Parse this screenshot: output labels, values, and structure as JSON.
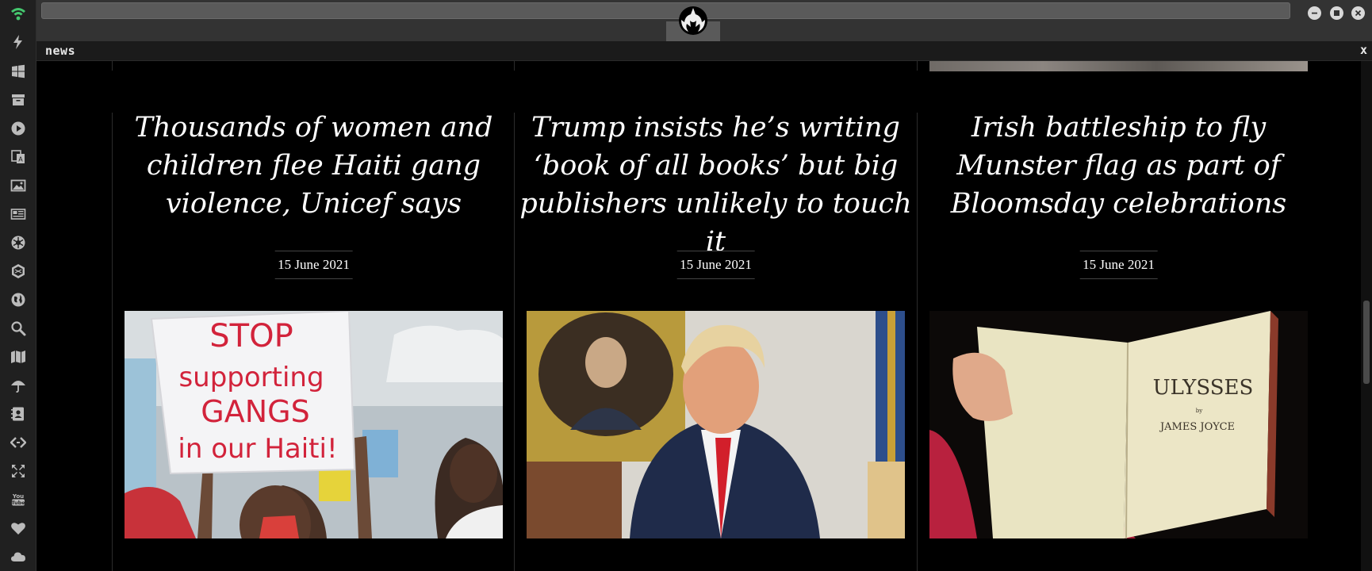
{
  "dock": {
    "items": [
      {
        "name": "wifi-icon",
        "active": true
      },
      {
        "name": "lightning-icon"
      },
      {
        "name": "windows-icon"
      },
      {
        "name": "archive-icon"
      },
      {
        "name": "play-icon"
      },
      {
        "name": "translate-icon"
      },
      {
        "name": "image-icon"
      },
      {
        "name": "newspaper-icon"
      },
      {
        "name": "rebel-emblem-icon"
      },
      {
        "name": "empire-emblem-icon"
      },
      {
        "name": "globe-icon"
      },
      {
        "name": "search-icon"
      },
      {
        "name": "map-icon"
      },
      {
        "name": "umbrella-icon"
      },
      {
        "name": "contacts-icon"
      },
      {
        "name": "code-icon"
      },
      {
        "name": "expand-icon"
      },
      {
        "name": "youtube-icon"
      },
      {
        "name": "heart-icon"
      },
      {
        "name": "cloud-icon"
      }
    ],
    "accent_color": "#44c76e"
  },
  "topbar": {
    "url_value": "",
    "brand_icon": "rebel-alliance-icon"
  },
  "panel": {
    "title": "news",
    "close_label": "x"
  },
  "articles": [
    {
      "title": "Thousands of women and children flee Haiti gang violence, Unicef says",
      "date": "15 June 2021",
      "sign_lines": [
        "STOP",
        "supporting",
        "GANGS",
        "in our Haiti!"
      ]
    },
    {
      "title": "Trump insists he’s writing ‘book of all books’ but big publishers unlikely to touch it",
      "date": "15 June 2021"
    },
    {
      "title": "Irish battleship to fly Munster flag as part of Bloomsday celebrations",
      "date": "15 June 2021",
      "book_title": "ULYSSES",
      "book_by": "by",
      "book_author": "JAMES JOYCE"
    }
  ]
}
